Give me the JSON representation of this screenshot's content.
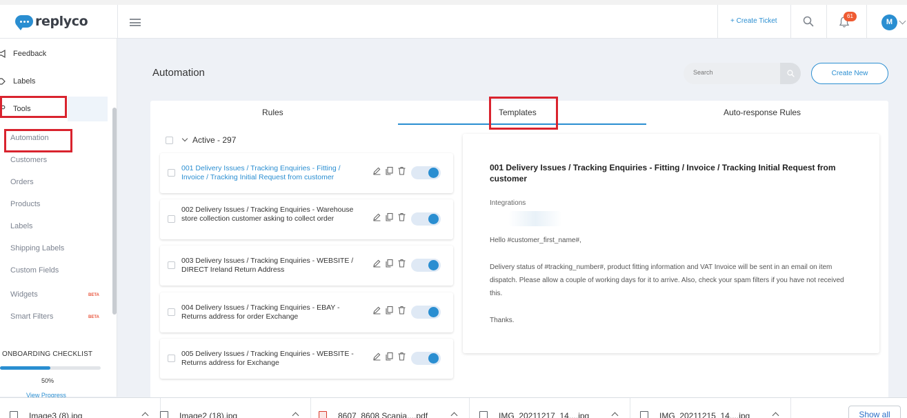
{
  "app": {
    "logo_text": "replyco"
  },
  "topbar": {
    "create_ticket": "+ Create Ticket",
    "notification_count": "61",
    "avatar_initial": "M"
  },
  "sidebar": {
    "items": [
      {
        "label": "Feedback",
        "icon": "megaphone-icon"
      },
      {
        "label": "Labels",
        "icon": "tag-icon"
      },
      {
        "label": "Tools",
        "icon": "wrench-icon"
      }
    ],
    "sub_items": [
      {
        "label": "Automation",
        "beta": ""
      },
      {
        "label": "Customers",
        "beta": ""
      },
      {
        "label": "Orders",
        "beta": ""
      },
      {
        "label": "Products",
        "beta": ""
      },
      {
        "label": "Labels",
        "beta": ""
      },
      {
        "label": "Shipping Labels",
        "beta": ""
      },
      {
        "label": "Custom Fields",
        "beta": ""
      },
      {
        "label": "Widgets",
        "beta": "BETA"
      },
      {
        "label": "Smart Filters",
        "beta": "BETA"
      }
    ],
    "onboarding": {
      "title": "ONBOARDING CHECKLIST",
      "percent_label": "50%",
      "progress": 0.5,
      "view_progress": "View Progress"
    }
  },
  "main": {
    "title": "Automation",
    "search": {
      "placeholder": "Search"
    },
    "create_new": "Create New",
    "tabs": [
      {
        "label": "Rules"
      },
      {
        "label": "Templates",
        "active": true
      },
      {
        "label": "Auto-response Rules"
      }
    ],
    "list_header": "Active - 297",
    "rules": [
      {
        "name": "001 Delivery Issues / Tracking Enquiries - Fitting / Invoice / Tracking Initial Request from customer",
        "selected": true,
        "enabled": true
      },
      {
        "name": "002 Delivery Issues / Tracking Enquiries - Warehouse store collection customer asking to collect order",
        "selected": false,
        "enabled": true
      },
      {
        "name": "003 Delivery Issues / Tracking Enquiries - WEBSITE / DIRECT Ireland Return Address",
        "selected": false,
        "enabled": true
      },
      {
        "name": "004 Delivery Issues / Tracking Enquiries - EBAY - Returns address for order Exchange",
        "selected": false,
        "enabled": true
      },
      {
        "name": "005 Delivery Issues / Tracking Enquiries - WEBSITE - Returns address for Exchange",
        "selected": false,
        "enabled": true
      }
    ],
    "preview": {
      "title": "001 Delivery Issues / Tracking Enquiries - Fitting / Invoice / Tracking Initial Request from customer",
      "integrations_label": "Integrations",
      "greeting": "Hello #customer_first_name#,",
      "body": "Delivery status of #tracking_number#, product fitting information and VAT Invoice will be sent in an email on item dispatch. Please allow a couple of working days for it to arrive. Also, check your spam filters if you have not received this.",
      "signoff": "Thanks."
    }
  },
  "downloads": {
    "items": [
      {
        "name": "Image3 (8).jpg",
        "type": "image"
      },
      {
        "name": "Image2 (18).jpg",
        "type": "image"
      },
      {
        "name": "8607_8608 Scania....pdf",
        "type": "pdf"
      },
      {
        "name": "IMG_20211217_14....jpg",
        "type": "image"
      },
      {
        "name": "IMG_20211215_14....jpg",
        "type": "image"
      }
    ],
    "show_all": "Show all"
  },
  "colors": {
    "accent": "#2a8ed1",
    "highlight_box": "#d9232e",
    "badge": "#ef5b32"
  }
}
